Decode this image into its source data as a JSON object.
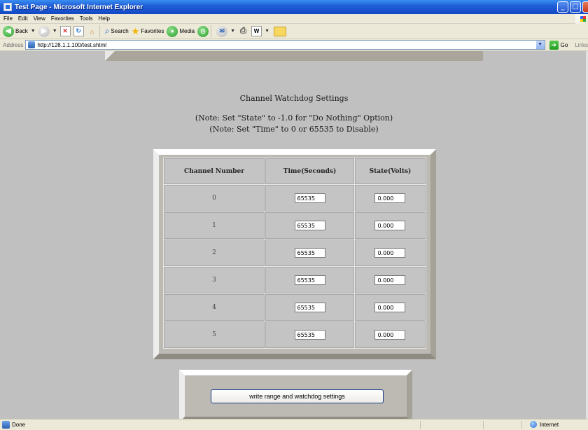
{
  "window": {
    "title": "Test Page - Microsoft Internet Explorer",
    "controls": {
      "minimize": "_",
      "maximize": "□",
      "close": ""
    }
  },
  "menubar": {
    "items": [
      "File",
      "Edit",
      "View",
      "Favorites",
      "Tools",
      "Help"
    ]
  },
  "toolbar": {
    "back_label": "Back",
    "search_label": "Search",
    "favorites_label": "Favorites",
    "media_label": "Media",
    "icons": [
      "back-icon",
      "forward-icon",
      "stop-icon",
      "refresh-icon",
      "home-icon",
      "search-icon",
      "favorites-icon",
      "media-icon",
      "history-icon",
      "mail-icon",
      "print-icon",
      "edit-icon",
      "folder-icon"
    ]
  },
  "addressbar": {
    "label": "Address",
    "url": "http://128.1.1.100/test.shtml",
    "go_label": "Go",
    "links_label": "Links"
  },
  "page": {
    "title": "Channel Watchdog Settings",
    "note1": "(Note: Set \"State\" to -1.0 for \"Do Nothing\" Option)",
    "note2": "(Note: Set \"Time\" to 0 or 65535 to Disable)",
    "table": {
      "headers": [
        "Channel Number",
        "Time(Seconds)",
        "State(Volts)"
      ],
      "rows": [
        {
          "channel": "0",
          "time": "65535",
          "state": "0.000"
        },
        {
          "channel": "1",
          "time": "65535",
          "state": "0.000"
        },
        {
          "channel": "2",
          "time": "65535",
          "state": "0.000"
        },
        {
          "channel": "3",
          "time": "65535",
          "state": "0.000"
        },
        {
          "channel": "4",
          "time": "65535",
          "state": "0.000"
        },
        {
          "channel": "5",
          "time": "65535",
          "state": "0.000"
        }
      ]
    },
    "submit_label": "write range and watchdog settings"
  },
  "statusbar": {
    "status": "Done",
    "zone": "Internet"
  },
  "colors": {
    "titlebar": "#1f5fd8",
    "chrome": "#ece9d8",
    "page_bg": "#c0c0c0"
  }
}
